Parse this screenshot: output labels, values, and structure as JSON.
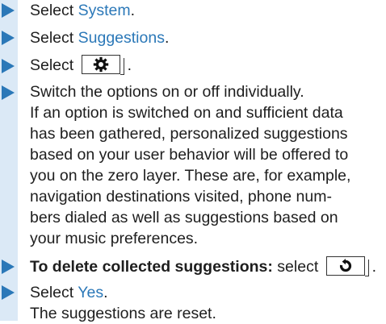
{
  "steps": {
    "s1": {
      "lead": "Select ",
      "link": "System",
      "tail": "."
    },
    "s2": {
      "lead": "Select ",
      "link": "Suggestions",
      "tail": "."
    },
    "s3": {
      "lead": "Select ",
      "tail": "."
    },
    "s4": {
      "lines": [
        "Switch the options on or off individually.",
        "If an option is switched on and sufficient data",
        "has been gathered, personalized suggestions",
        "based on your user behavior will be offered to",
        "you on the zero layer. These are, for example,",
        "navigation destinations visited, phone num-",
        "bers dialed as well as suggestions based on",
        "your music preferences."
      ]
    },
    "s5": {
      "bold": "To delete collected suggestions:",
      "mid": " select ",
      "tail": "."
    },
    "s6": {
      "lead": "Select ",
      "link": "Yes",
      "tail": ".",
      "result": "The suggestions are reset."
    }
  },
  "icons": {
    "settings_button": "gear-icon",
    "reset_button": "reset-icon"
  },
  "colors": {
    "accent": "#2b78b8",
    "band": "#dbe9f6",
    "text": "#1e1e1e"
  }
}
